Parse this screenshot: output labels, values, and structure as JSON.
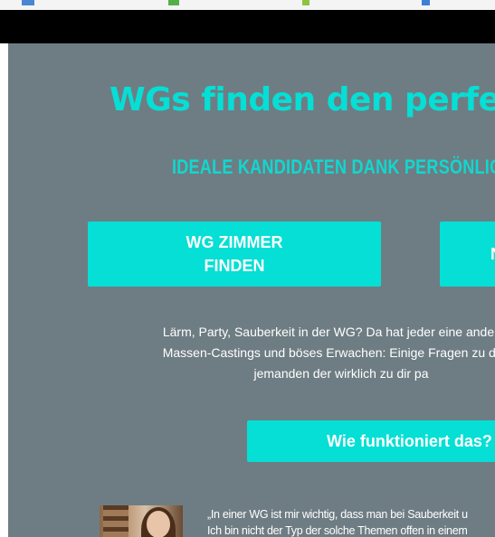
{
  "hero": {
    "title": "WGs finden den perfekte",
    "subtitle": "IDEALE KANDIDATEN DANK PERSÖNLIC"
  },
  "buttons": {
    "find_room": "WG ZIMMER FINDEN",
    "find_room_line1": "WG ZIMMER",
    "find_room_line2": "FINDEN",
    "second": "N",
    "how": "Wie funktioniert das?"
  },
  "intro": {
    "line1": "Lärm, Party, Sauberkeit in der WG? Da hat jeder eine andere M",
    "line2": "Massen-Castings und böses Erwachen: Einige Fragen zu deine",
    "line3": "jemanden der wirklich zu dir pa"
  },
  "testimonial": {
    "line1": "„In einer WG ist mir wichtig, dass man bei Sauberkeit u",
    "line2": "Ich bin nicht der Typ der solche Themen offen in einem"
  },
  "colors": {
    "accent": "#05dfd5",
    "page_background": "#6e7d83",
    "header_bar": "#000000"
  }
}
